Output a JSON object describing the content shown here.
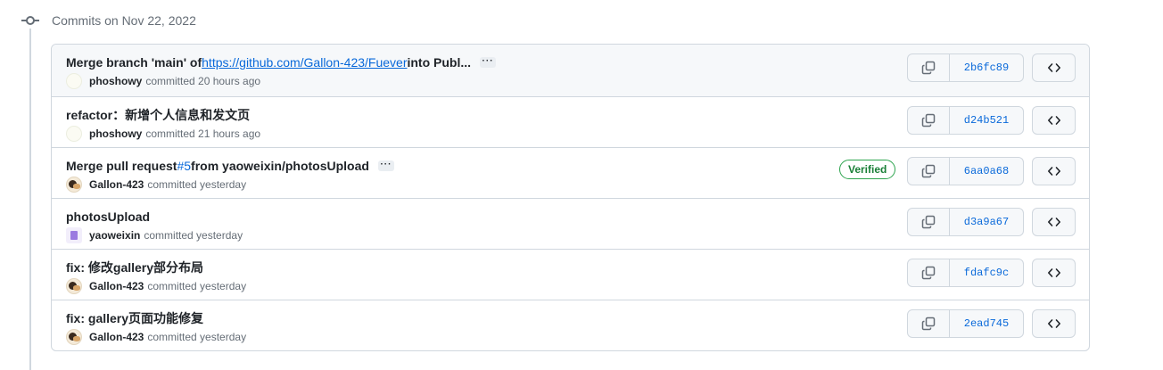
{
  "group": {
    "title": "Commits on Nov 22, 2022"
  },
  "commits": [
    {
      "message_prefix": "Merge branch 'main' of ",
      "message_link": "https://github.com/Gallon-423/Fuever",
      "message_suffix": " into Publ...",
      "author": "phoshowy",
      "time": "committed 20 hours ago",
      "sha": "2b6fc89",
      "avatar": "pale"
    },
    {
      "message": "refactor：新增个人信息和发文页",
      "author": "phoshowy",
      "time": "committed 21 hours ago",
      "sha": "d24b521",
      "avatar": "pale"
    },
    {
      "message_prefix": "Merge pull request ",
      "message_link": "#5",
      "message_suffix": " from yaoweixin/photosUpload",
      "author": "Gallon-423",
      "time": "committed yesterday",
      "sha": "6aa0a68",
      "badge": "Verified",
      "avatar": "dog"
    },
    {
      "message": "photosUpload",
      "author": "yaoweixin",
      "time": "committed yesterday",
      "sha": "d3a9a67",
      "avatar": "purple"
    },
    {
      "message": "fix: 修改gallery部分布局",
      "author": "Gallon-423",
      "time": "committed yesterday",
      "sha": "fdafc9c",
      "avatar": "dog"
    },
    {
      "message": "fix: gallery页面功能修复",
      "author": "Gallon-423",
      "time": "committed yesterday",
      "sha": "2ead745",
      "avatar": "dog"
    }
  ],
  "icons": {
    "timeline": "git-commit-icon",
    "copy": "copy-icon",
    "browse": "code-icon",
    "expand": "ellipsis-icon"
  },
  "colors": {
    "link": "#0969da",
    "verified": "#1a7f37",
    "border": "#d0d7de",
    "muted": "#656d76"
  }
}
